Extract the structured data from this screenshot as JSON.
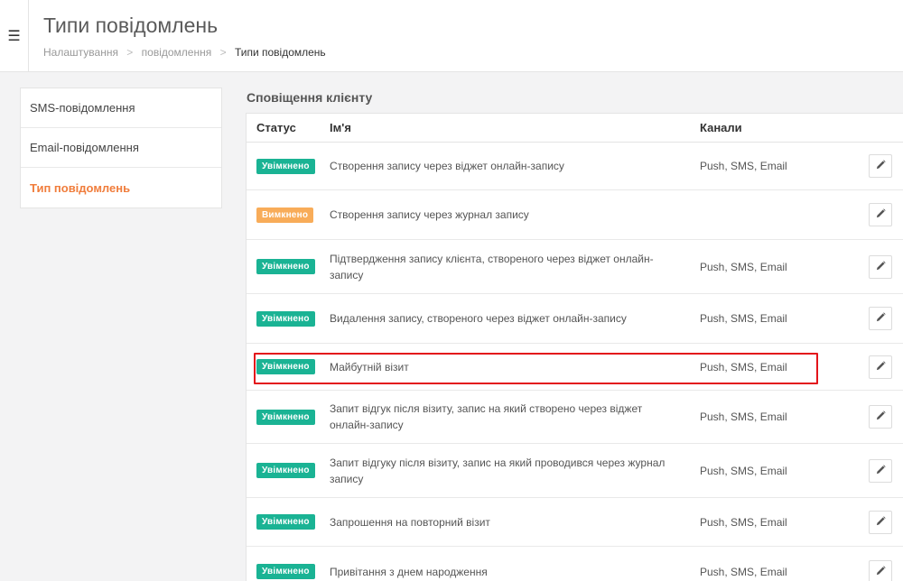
{
  "header": {
    "menu_icon": "☰",
    "title": "Типи повідомлень",
    "breadcrumb": [
      "Налаштування",
      "повідомлення",
      "Типи повідомлень"
    ],
    "breadcrumb_sep": ">"
  },
  "sidebar": {
    "items": [
      {
        "label": "SMS-повідомлення",
        "active": false
      },
      {
        "label": "Email-повідомлення",
        "active": false
      },
      {
        "label": "Тип повідомлень",
        "active": true
      }
    ]
  },
  "main": {
    "section_title": "Сповіщення клієнту",
    "columns": {
      "status": "Статус",
      "name": "Ім'я",
      "channels": "Канали"
    },
    "rows": [
      {
        "status": "Увімкнено",
        "state": "on",
        "name": "Створення запису через віджет онлайн-запису",
        "channels": "Push, SMS, Email"
      },
      {
        "status": "Вимкнено",
        "state": "off",
        "name": "Створення запису через журнал запису",
        "channels": ""
      },
      {
        "status": "Увімкнено",
        "state": "on",
        "name": "Підтвердження запису клієнта, створеного через віджет онлайн-запису",
        "channels": "Push, SMS, Email"
      },
      {
        "status": "Увімкнено",
        "state": "on",
        "name": "Видалення запису, створеного через віджет онлайн-запису",
        "channels": "Push, SMS, Email"
      },
      {
        "status": "Увімкнено",
        "state": "on",
        "name": "Майбутній візит",
        "channels": "Push, SMS, Email"
      },
      {
        "status": "Увімкнено",
        "state": "on",
        "name": "Запит відгук після візиту, запис на який створено через віджет онлайн-запису",
        "channels": "Push, SMS, Email"
      },
      {
        "status": "Увімкнено",
        "state": "on",
        "name": "Запит відгуку після візиту, запис на який проводився через журнал запису",
        "channels": "Push, SMS, Email"
      },
      {
        "status": "Увімкнено",
        "state": "on",
        "name": "Запрошення на повторний візит",
        "channels": "Push, SMS, Email"
      },
      {
        "status": "Увімкнено",
        "state": "on",
        "name": "Привітання з днем народження",
        "channels": "Push, SMS, Email"
      }
    ]
  },
  "icons": {
    "edit": "pencil-icon",
    "menu": "hamburger-icon"
  },
  "colors": {
    "enabled": "#1ab394",
    "disabled": "#f8ac59",
    "active_nav": "#f07d3c",
    "highlight": "#e3141b"
  }
}
